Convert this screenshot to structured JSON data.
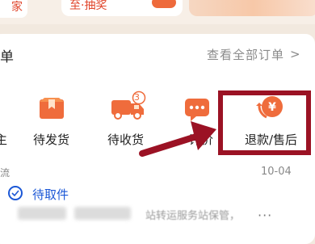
{
  "top": {
    "left_text": "家",
    "promo_text": "至·抽奖"
  },
  "orders": {
    "title": "单",
    "view_all": "查看全部订单",
    "chevron": ">",
    "items": [
      {
        "label": "主",
        "icon": "partial-icon"
      },
      {
        "label": "待发货",
        "icon": "box-icon"
      },
      {
        "label": "待收货",
        "icon": "truck-icon",
        "badge": "3"
      },
      {
        "label": "评价",
        "icon": "chat-dots-icon"
      },
      {
        "label": "退款/售后",
        "icon": "refund-yen-icon"
      }
    ]
  },
  "logistics": {
    "category": "流",
    "date": "10-04",
    "status": "待取件",
    "detail": "站转运服务站保管，",
    "more": "···"
  },
  "colors": {
    "accent": "#ee6a3b",
    "highlight": "#9b1224",
    "link": "#1b57d6"
  }
}
